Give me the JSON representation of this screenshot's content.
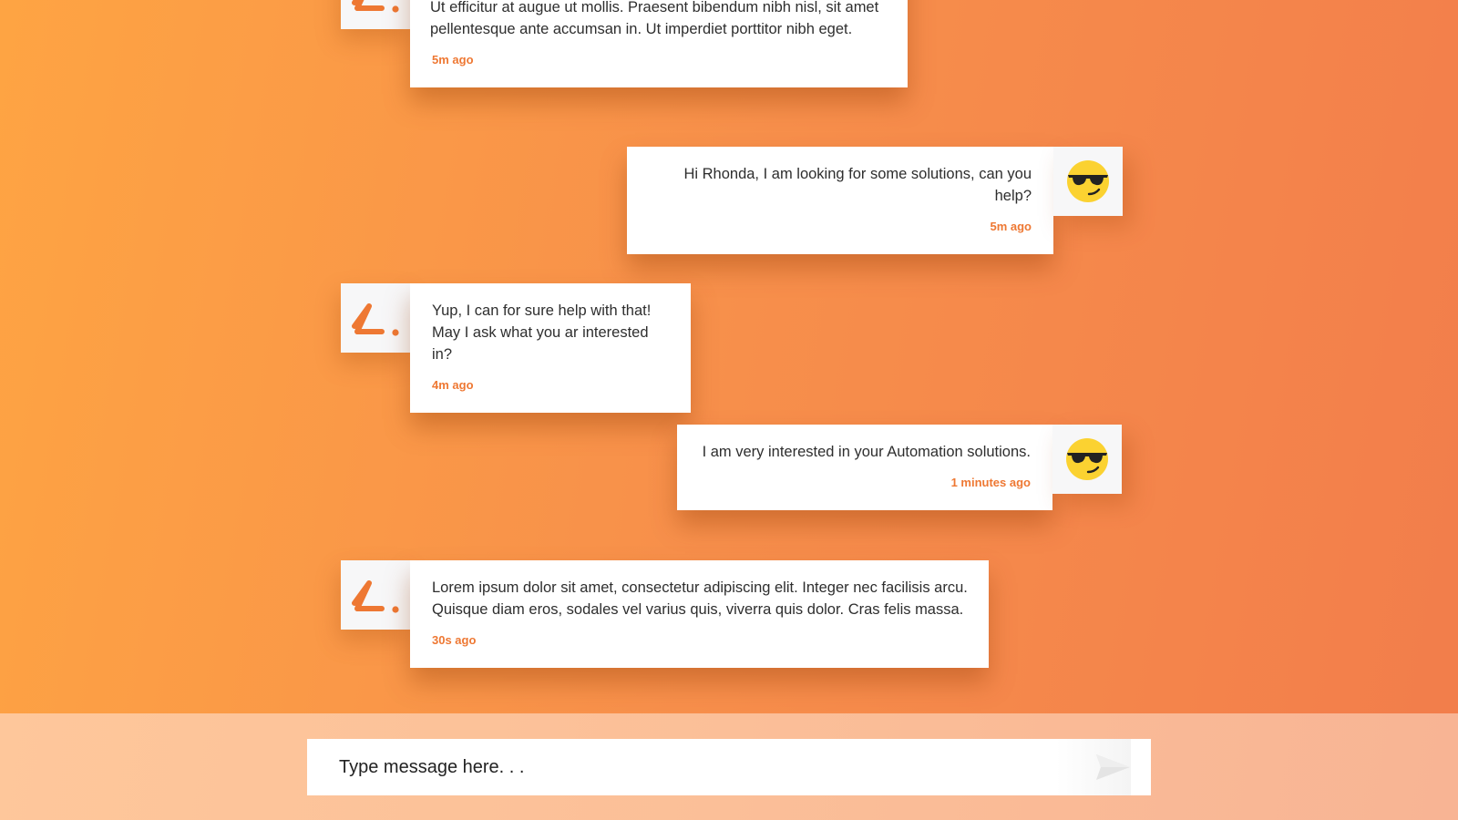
{
  "messages": [
    {
      "side": "left",
      "avatar_icon": "brand-logo-icon",
      "text": "Ut efficitur at augue ut mollis. Praesent bibendum nibh nisl, sit amet\npellentesque ante accumsan in. Ut imperdiet porttitor nibh eget.",
      "time": "5m ago"
    },
    {
      "side": "right",
      "avatar_icon": "sunglasses-emoji-icon",
      "text": "Hi Rhonda, I am looking for some solutions, can you help?",
      "time": "5m ago"
    },
    {
      "side": "left",
      "avatar_icon": "brand-logo-icon",
      "text": "Yup, I can for sure help with that!\nMay I ask what you ar interested in?",
      "time": "4m ago"
    },
    {
      "side": "right",
      "avatar_icon": "sunglasses-emoji-icon",
      "text": "I am very interested in your Automation solutions.",
      "time": "1 minutes ago"
    },
    {
      "side": "left",
      "avatar_icon": "brand-logo-icon",
      "text": "Lorem ipsum dolor sit amet, consectetur adipiscing elit. Integer nec facilisis arcu.\nQuisque diam eros, sodales vel varius quis, viverra quis dolor. Cras felis massa.",
      "time": "30s ago"
    }
  ],
  "composer": {
    "placeholder": "Type message here. . .",
    "send_icon": "send-icon"
  },
  "colors": {
    "accent": "#ee7833",
    "bg_start": "#fea443",
    "bg_end": "#f27d4b",
    "emoji_yellow": "#fbd231"
  }
}
